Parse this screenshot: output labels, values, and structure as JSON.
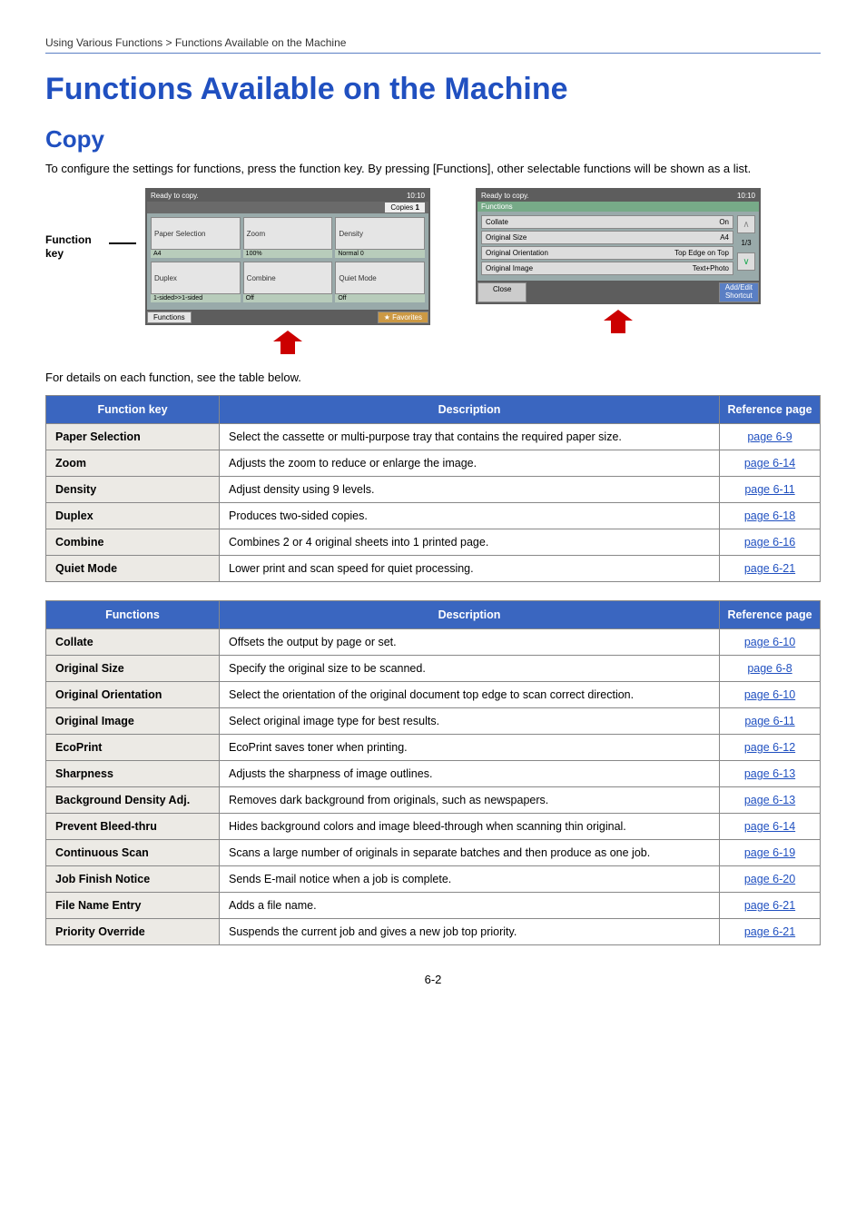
{
  "breadcrumb": "Using Various Functions > Functions Available on the Machine",
  "h1": "Functions Available on the Machine",
  "h2": "Copy",
  "intro": "To configure the settings for functions, press the function key. By pressing [Functions], other selectable functions will be shown as a list.",
  "fk_label_line1": "Function",
  "fk_label_line2": "key",
  "panel1": {
    "status": "Ready to copy.",
    "time": "10:10",
    "copies_label": "Copies",
    "copies_value": "1",
    "cells": [
      {
        "title": "Paper Selection",
        "sub": "A4",
        "name": "paper-selection-cell"
      },
      {
        "title": "Zoom",
        "sub": "100%",
        "name": "zoom-cell"
      },
      {
        "title": "Density",
        "sub": "Normal 0",
        "name": "density-cell"
      },
      {
        "title": "Duplex",
        "sub": "1-sided>>1-sided",
        "name": "duplex-cell"
      },
      {
        "title": "Combine",
        "sub": "Off",
        "name": "combine-cell"
      },
      {
        "title": "Quiet Mode",
        "sub": "Off",
        "name": "quiet-mode-cell"
      }
    ],
    "functions_btn": "Functions",
    "favorites_btn": "Favorites"
  },
  "panel2": {
    "status": "Ready to copy.",
    "time": "10:10",
    "header": "Functions",
    "rows": [
      {
        "label": "Collate",
        "value": "On",
        "name": "collate-row"
      },
      {
        "label": "Original Size",
        "value": "A4",
        "name": "original-size-row"
      },
      {
        "label": "Original Orientation",
        "value": "Top Edge on Top",
        "name": "original-orientation-row"
      },
      {
        "label": "Original Image",
        "value": "Text+Photo",
        "name": "original-image-row"
      }
    ],
    "page_indicator": "1/3",
    "close_btn": "Close",
    "addedit_line1": "Add/Edit",
    "addedit_line2": "Shortcut"
  },
  "caption": "For details on each function, see the table below.",
  "table1": {
    "headers": [
      "Function key",
      "Description",
      "Reference page"
    ],
    "rows": [
      {
        "key": "Paper Selection",
        "desc": "Select the cassette or multi-purpose tray that contains the required paper size.",
        "ref": "page 6-9"
      },
      {
        "key": "Zoom",
        "desc": "Adjusts the zoom to reduce or enlarge the image.",
        "ref": "page 6-14"
      },
      {
        "key": "Density",
        "desc": "Adjust density using 9 levels.",
        "ref": "page 6-11"
      },
      {
        "key": "Duplex",
        "desc": "Produces two-sided copies.",
        "ref": "page 6-18"
      },
      {
        "key": "Combine",
        "desc": "Combines 2 or 4 original sheets into 1 printed page.",
        "ref": "page 6-16"
      },
      {
        "key": "Quiet Mode",
        "desc": "Lower print and scan speed for quiet processing.",
        "ref": "page 6-21"
      }
    ]
  },
  "table2": {
    "headers": [
      "Functions",
      "Description",
      "Reference page"
    ],
    "rows": [
      {
        "key": "Collate",
        "desc": "Offsets the output by page or set.",
        "ref": "page 6-10"
      },
      {
        "key": "Original Size",
        "desc": "Specify the original size to be scanned.",
        "ref": "page 6-8"
      },
      {
        "key": "Original Orientation",
        "desc": "Select the orientation of the original document top edge to scan correct direction.",
        "ref": "page 6-10"
      },
      {
        "key": "Original Image",
        "desc": "Select original image type for best results.",
        "ref": "page 6-11"
      },
      {
        "key": "EcoPrint",
        "desc": "EcoPrint saves toner when printing.",
        "ref": "page 6-12"
      },
      {
        "key": "Sharpness",
        "desc": "Adjusts the sharpness of image outlines.",
        "ref": "page 6-13"
      },
      {
        "key": "Background Density Adj.",
        "desc": "Removes dark background from originals, such as newspapers.",
        "ref": "page 6-13"
      },
      {
        "key": "Prevent Bleed-thru",
        "desc": "Hides background colors and image bleed-through when scanning thin original.",
        "ref": "page 6-14"
      },
      {
        "key": "Continuous Scan",
        "desc": "Scans a large number of originals in separate batches and then produce as one job.",
        "ref": "page 6-19"
      },
      {
        "key": "Job Finish Notice",
        "desc": "Sends E-mail notice when a job is complete.",
        "ref": "page 6-20"
      },
      {
        "key": "File Name Entry",
        "desc": "Adds a file name.",
        "ref": "page 6-21"
      },
      {
        "key": "Priority Override",
        "desc": "Suspends the current job and gives a new job top priority.",
        "ref": "page 6-21"
      }
    ]
  },
  "pagenum": "6-2"
}
